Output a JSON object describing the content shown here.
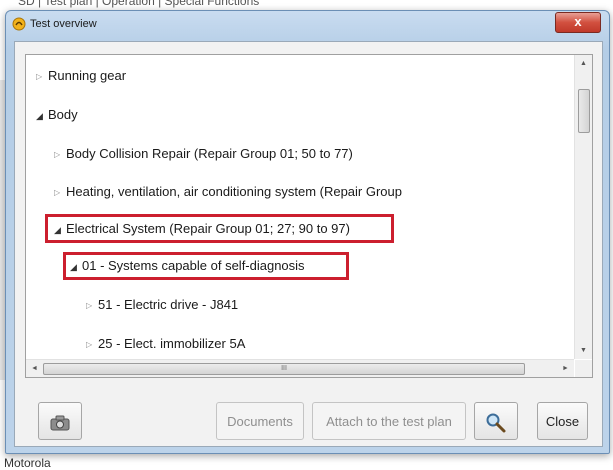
{
  "background": {
    "title_fragment": "SD | Test plan | Operation | Special Functions",
    "bottom_text": "Motorola"
  },
  "window": {
    "title": "Test overview",
    "close_glyph": "x"
  },
  "tree": {
    "items": [
      {
        "label": "Running gear",
        "expanded": false
      },
      {
        "label": "Body",
        "expanded": true
      },
      {
        "label": "Body Collision Repair (Repair Group 01; 50  to 77)",
        "expanded": false
      },
      {
        "label": "Heating, ventilation, air conditioning system (Repair Group",
        "expanded": false
      },
      {
        "label": "Electrical System (Repair Group 01; 27; 90 to 97)",
        "expanded": true,
        "highlighted": true
      },
      {
        "label": "01 - Systems capable of self-diagnosis",
        "expanded": true,
        "highlighted": true
      },
      {
        "label": "51 - Electric drive - J841",
        "expanded": false
      },
      {
        "label": "25 - Elect. immobilizer 5A",
        "expanded": false
      }
    ]
  },
  "scrollbars": {
    "up": "▲",
    "down": "▼",
    "left": "◄",
    "right": "►",
    "h_grip": "III"
  },
  "buttons": {
    "camera_icon": "camera-icon",
    "documents": "Documents",
    "attach": "Attach to the test plan",
    "search_icon": "magnifier-icon",
    "close": "Close"
  },
  "colors": {
    "highlight": "#cc1f2e",
    "window_frame": "#b9d1ea"
  }
}
